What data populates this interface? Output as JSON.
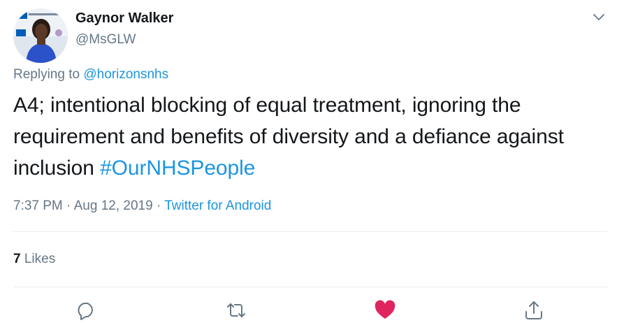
{
  "author": {
    "name": "Gaynor Walker",
    "handle": "@MsGLW"
  },
  "reply": {
    "prefix": "Replying to",
    "to": "@horizonsnhs"
  },
  "tweet": {
    "text": "A4; intentional blocking of equal treatment, ignoring the requirement and benefits of diversity and a defiance against inclusion",
    "hashtag": "#OurNHSPeople"
  },
  "meta": {
    "time": "7:37 PM",
    "separator1": "·",
    "date": "Aug 12, 2019",
    "separator2": "·",
    "source": "Twitter for Android"
  },
  "stats": {
    "likes_count": "7",
    "likes_label": "Likes"
  },
  "actions": {
    "reply_icon": "comment-bubble-icon",
    "retweet_icon": "retweet-icon",
    "like_icon": "heart-icon",
    "share_icon": "share-upload-icon"
  },
  "colors": {
    "link": "#1b95e0",
    "muted": "#657786",
    "like_active": "#e0245e",
    "divider": "#e6ecf0"
  }
}
